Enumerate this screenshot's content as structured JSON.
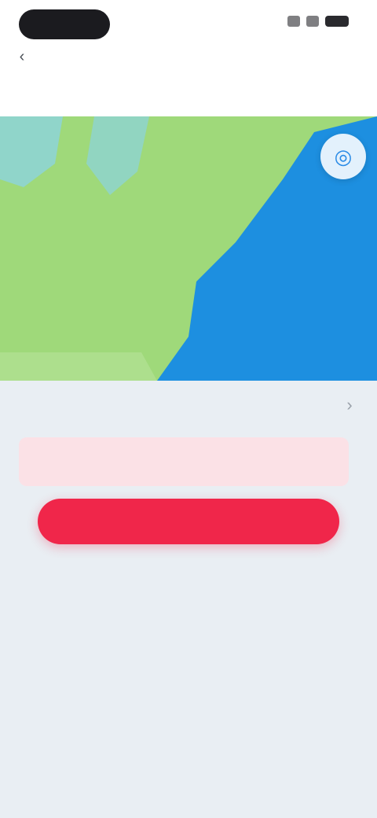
{
  "status_bar": {
    "icons": [
      "signal-icon",
      "wifi-icon",
      "battery-icon"
    ]
  },
  "header": {
    "title": "",
    "subtitle": "",
    "back_icon": "chevron-left-icon"
  },
  "map": {
    "control_icon": "compass-icon",
    "land_color": "#9fd97a",
    "water_color": "#1d8fe0"
  },
  "section": {
    "heading": "",
    "action_icon": "chevron-right-icon"
  },
  "alert": {
    "text": ""
  },
  "cta": {
    "label": ""
  },
  "colors": {
    "accent": "#f0264a",
    "alert_bg": "#fbe1e6",
    "background": "#e9eef3"
  }
}
